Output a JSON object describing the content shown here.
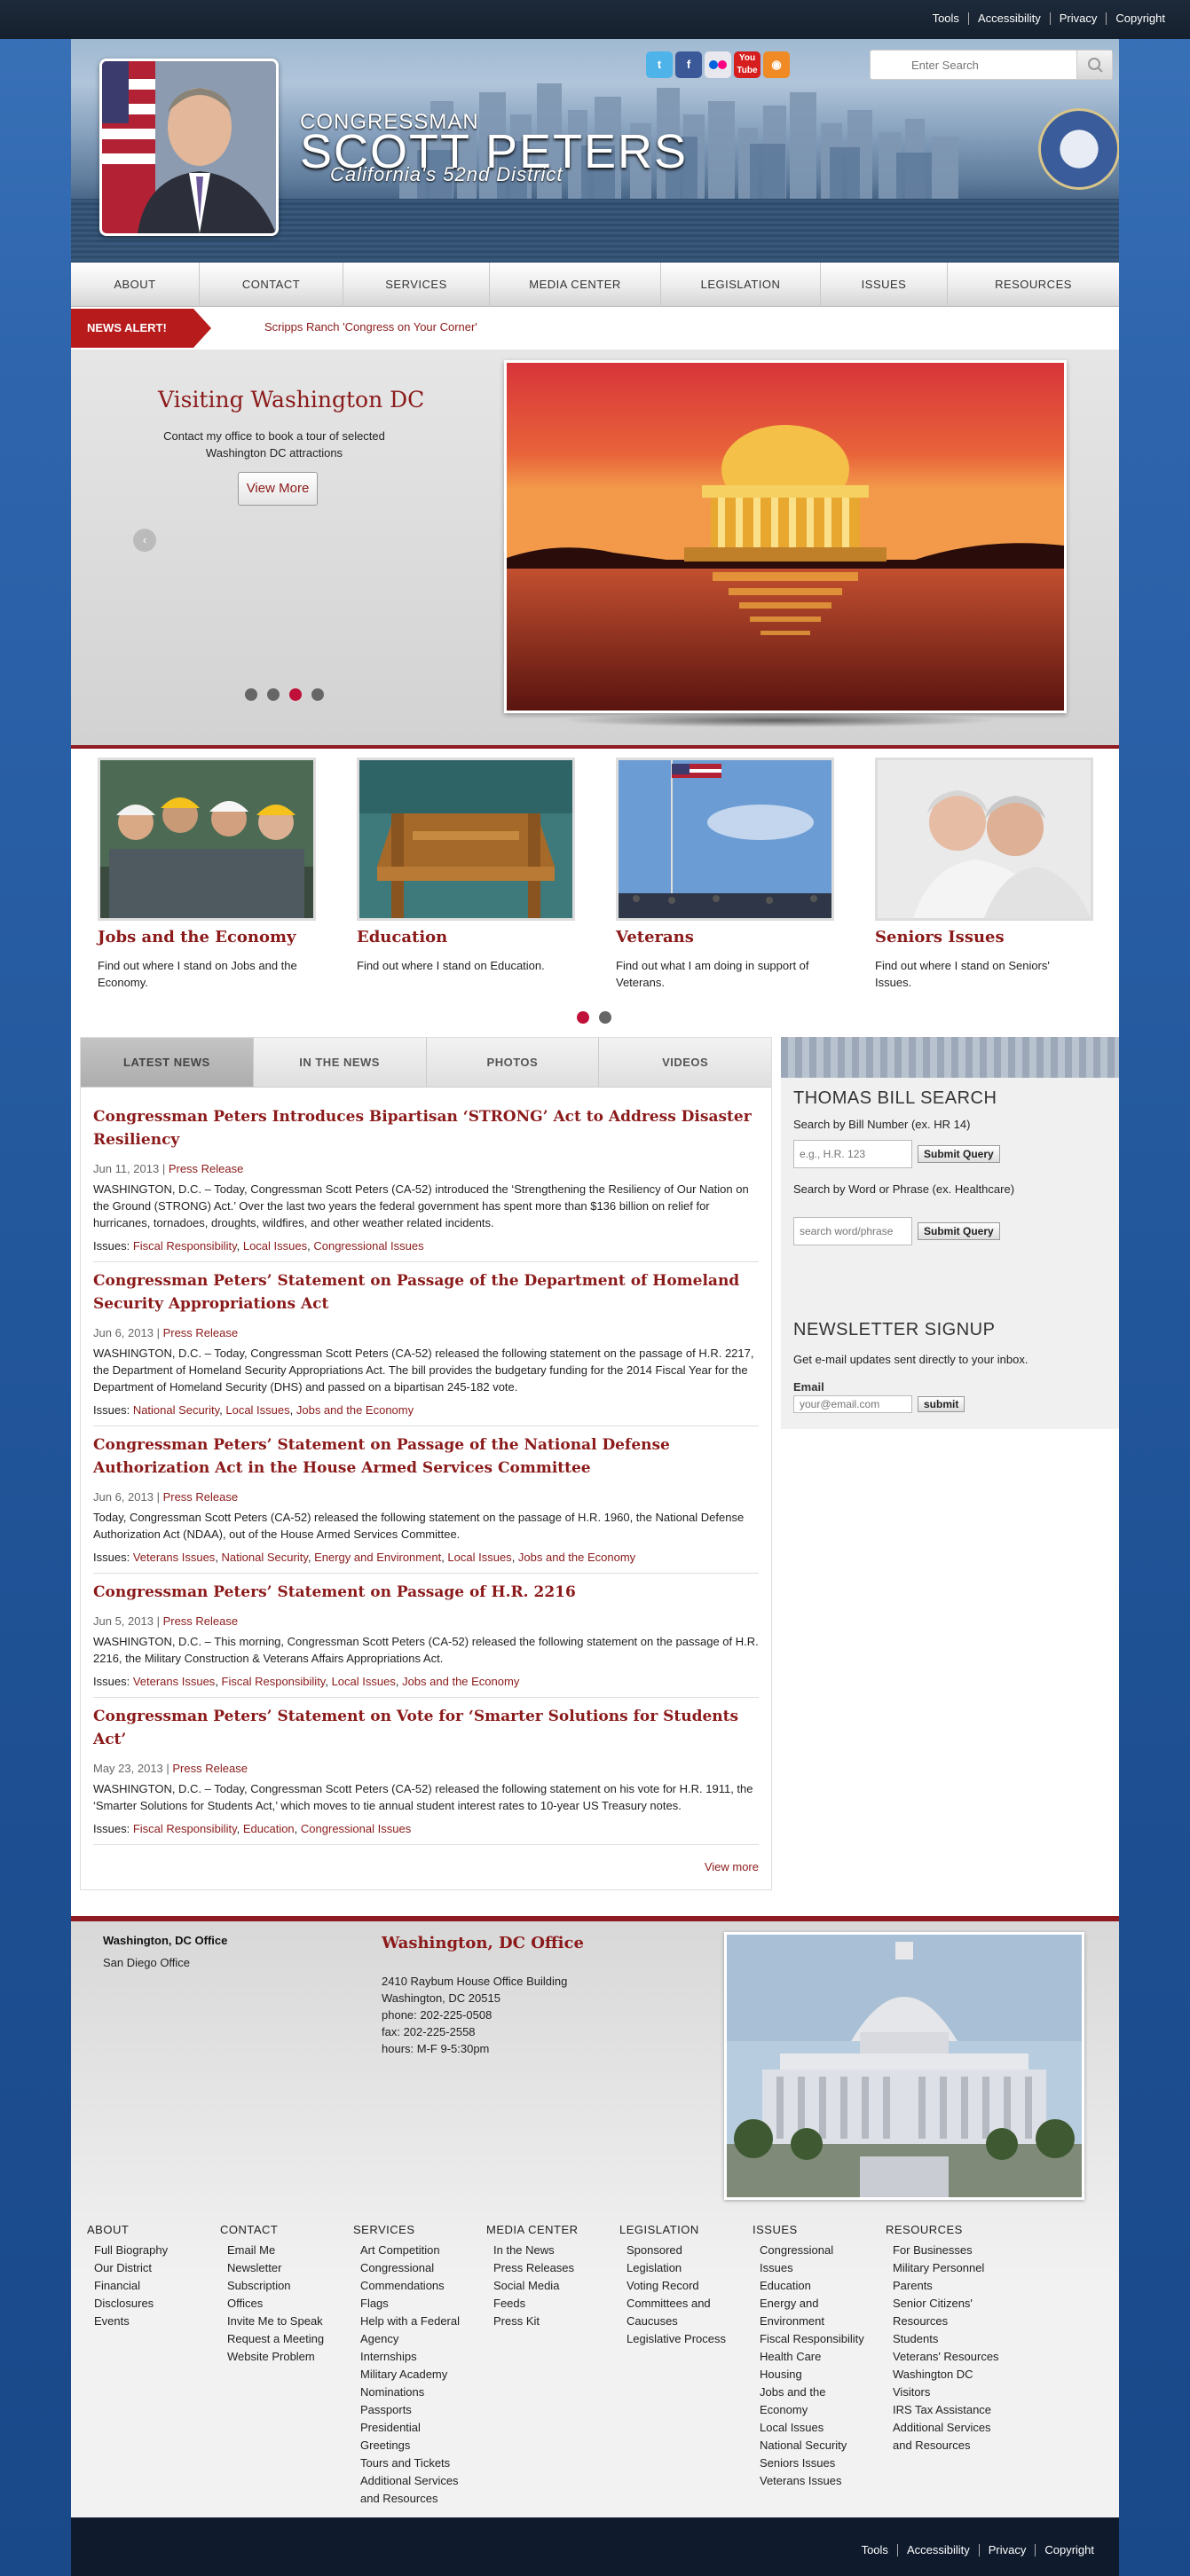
{
  "util_links": [
    "Tools",
    "Accessibility",
    "Privacy",
    "Copyright"
  ],
  "header": {
    "congressman": "CONGRESSMAN",
    "name": "SCOTT PETERS",
    "district": "California's 52nd District",
    "search_placeholder": "Enter Search",
    "social": [
      "Twitter",
      "Facebook",
      "Flickr",
      "YouTube",
      "RSS"
    ],
    "seal_alt": "U.S. House of Representatives"
  },
  "nav": [
    "ABOUT",
    "CONTACT",
    "SERVICES",
    "MEDIA CENTER",
    "LEGISLATION",
    "ISSUES",
    "RESOURCES"
  ],
  "alert": {
    "tag": "NEWS ALERT!",
    "text": "Scripps Ranch 'Congress on Your Corner'"
  },
  "slider": {
    "title": "Visiting Washington DC",
    "desc": "Contact my office to book a tour of selected Washington DC attractions",
    "button": "View More",
    "dots_active_index": 2
  },
  "issues": [
    {
      "title": "Jobs and the Economy",
      "desc": "Find out where I stand on Jobs and the Economy."
    },
    {
      "title": "Education",
      "desc": "Find out where I stand on Education."
    },
    {
      "title": "Veterans",
      "desc": "Find out what I am doing in support of Veterans."
    },
    {
      "title": "Seniors Issues",
      "desc": "Find out where I stand on Seniors' Issues."
    }
  ],
  "news_tabs": [
    "LATEST NEWS",
    "IN THE NEWS",
    "PHOTOS",
    "VIDEOS"
  ],
  "articles": [
    {
      "title": "Congressman Peters Introduces Bipartisan ‘STRONG’ Act to Address Disaster Resiliency",
      "date": "Jun 11, 2013",
      "type": "Press Release",
      "body": "WASHINGTON, D.C. – Today, Congressman Scott Peters (CA-52) introduced the ‘Strengthening the Resiliency of Our Nation on the Ground (STRONG) Act.’ Over the last two years the federal government has spent more than $136 billion on relief for hurricanes, tornadoes, droughts, wildfires, and other weather related incidents.",
      "tags": [
        "Fiscal Responsibility",
        "Local Issues",
        "Congressional Issues"
      ]
    },
    {
      "title": "Congressman Peters’ Statement on Passage of the Department of Homeland Security Appropriations Act",
      "date": "Jun 6, 2013",
      "type": "Press Release",
      "body": "WASHINGTON, D.C. – Today, Congressman Scott Peters (CA-52) released the following statement on the passage of H.R. 2217, the Department of Homeland Security Appropriations Act. The bill provides the budgetary funding for the 2014 Fiscal Year for the Department of Homeland Security (DHS) and passed on a bipartisan 245-182 vote.",
      "tags": [
        "National Security",
        "Local Issues",
        "Jobs and the Economy"
      ]
    },
    {
      "title": "Congressman Peters’ Statement on Passage of the National Defense Authorization Act in the House Armed Services Committee",
      "date": "Jun 6, 2013",
      "type": "Press Release",
      "body": "Today, Congressman Scott Peters (CA-52) released the following statement on the passage of H.R. 1960, the National Defense Authorization Act (NDAA), out of the House Armed Services Committee.",
      "tags": [
        "Veterans Issues",
        "National Security",
        "Energy and Environment",
        "Local Issues",
        "Jobs and the Economy"
      ]
    },
    {
      "title": "Congressman Peters’ Statement on Passage of H.R. 2216",
      "date": "Jun 5, 2013",
      "type": "Press Release",
      "body": "WASHINGTON, D.C. – This morning, Congressman Scott Peters (CA-52) released the following statement on the passage of H.R. 2216, the Military Construction & Veterans Affairs Appropriations Act.",
      "tags": [
        "Veterans Issues",
        "Fiscal Responsibility",
        "Local Issues",
        "Jobs and the Economy"
      ]
    },
    {
      "title": "Congressman Peters’ Statement on Vote for ‘Smarter Solutions for Students Act’",
      "date": "May 23, 2013",
      "type": "Press Release",
      "body": "WASHINGTON, D.C. – Today, Congressman Scott Peters (CA-52) released the following statement on his vote for H.R. 1911, the ‘Smarter Solutions for Students Act,’ which moves to tie annual student interest rates to 10-year US Treasury notes.",
      "tags": [
        "Fiscal Responsibility",
        "Education",
        "Congressional Issues"
      ]
    }
  ],
  "issues_label": "Issues:",
  "view_more": "View more",
  "bill_search": {
    "title": "THOMAS BILL SEARCH",
    "by_number_label": "Search by Bill Number (ex. HR 14)",
    "number_placeholder": "e.g., H.R. 123",
    "submit": "Submit Query",
    "by_word_label": "Search by Word or Phrase (ex. Healthcare)",
    "word_placeholder": "search word/phrase"
  },
  "newsletter": {
    "title": "NEWSLETTER SIGNUP",
    "desc": "Get e-mail updates sent directly to your inbox.",
    "email_label": "Email",
    "email_placeholder": "your@email.com",
    "submit": "submit"
  },
  "offices": {
    "tabs": [
      "Washington, DC Office",
      "San Diego Office"
    ],
    "heading": "Washington, DC Office",
    "lines": [
      "2410 Raybum House Office Building",
      "Washington, DC 20515",
      "phone: 202-225-0508",
      "fax: 202-225-2558",
      "hours: M-F 9-5:30pm"
    ]
  },
  "footer_cols": [
    {
      "h": "ABOUT",
      "items": [
        "Full Biography",
        "Our District",
        "Financial Disclosures",
        "Events"
      ]
    },
    {
      "h": "CONTACT",
      "items": [
        "Email Me",
        "Newsletter",
        "Subscription Offices",
        "Invite Me to Speak",
        "Request a Meeting",
        "Website Problem"
      ]
    },
    {
      "h": "SERVICES",
      "items": [
        "Art Competition",
        "Congressional Commendations",
        "Flags",
        "Help with a Federal Agency",
        "Internships",
        "Military Academy Nominations",
        "Passports",
        "Presidential Greetings",
        "Tours and Tickets",
        "Additional Services and Resources"
      ]
    },
    {
      "h": "MEDIA CENTER",
      "items": [
        "In the News",
        "Press Releases",
        "Social Media",
        "Feeds",
        "Press Kit"
      ]
    },
    {
      "h": "LEGISLATION",
      "items": [
        "Sponsored Legislation",
        "Voting Record",
        "Committees and Caucuses",
        "Legislative Process"
      ]
    },
    {
      "h": "ISSUES",
      "items": [
        "Congressional Issues",
        "Education",
        "Energy and Environment",
        "Fiscal Responsibility",
        "Health Care",
        "Housing",
        "Jobs and the Economy",
        "Local Issues",
        "National Security",
        "Seniors Issues",
        "Veterans Issues"
      ]
    },
    {
      "h": "RESOURCES",
      "items": [
        "For Businesses",
        "Military Personnel",
        "Parents",
        "Senior Citizens' Resources",
        "Students",
        "Veterans' Resources",
        "Washington DC Visitors",
        "IRS Tax Assistance",
        "Additional Services and Resources"
      ]
    }
  ],
  "bottom_links": [
    "Tools",
    "Accessibility",
    "Privacy",
    "Copyright"
  ]
}
